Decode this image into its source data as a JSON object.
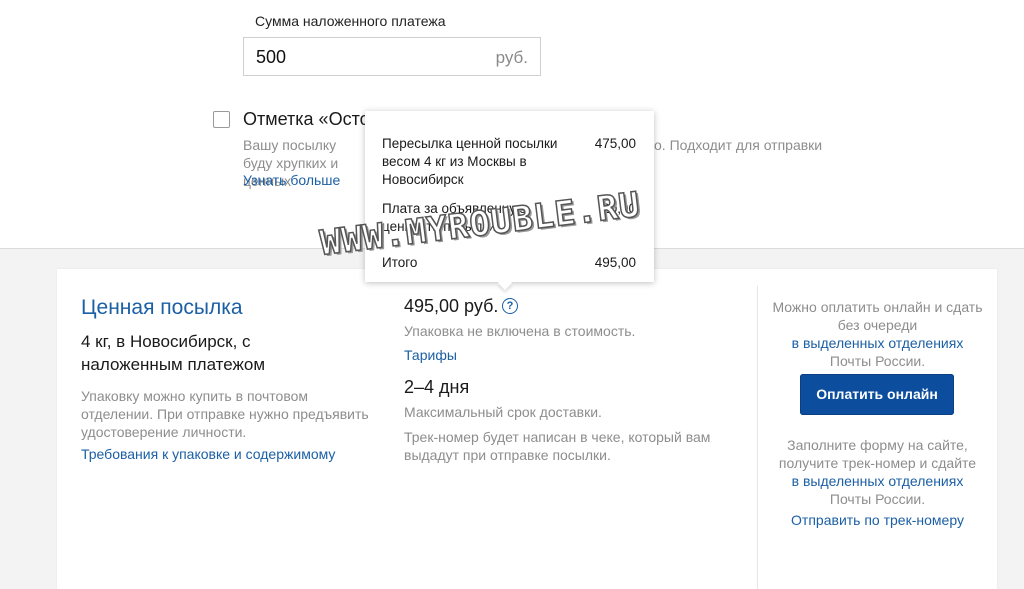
{
  "cod": {
    "label": "Сумма наложенного платежа",
    "value": "500",
    "unit": "руб."
  },
  "careful": {
    "label": "Отметка «Осто",
    "desc_left": "Вашу посылку буду хрупких и ценных",
    "desc_right": "о. Подходит для отправки",
    "learn_more": "Узнать больше"
  },
  "tooltip": {
    "rows": [
      {
        "label": "Пересылка ценной посылки весом 4 кг из Москвы в Новосибирск",
        "value": "475,00"
      },
      {
        "label": "Плата за объявленную ценность посылки",
        "value": "20,00"
      },
      {
        "label": "Итого",
        "value": "495,00"
      }
    ]
  },
  "watermark": "WWW.MYROUBLE.RU",
  "card": {
    "title": "Ценная посылка",
    "subtitle": "4 кг, в Новосибирск, с наложенным платежом",
    "note": "Упаковку можно купить в почтовом отделении. При отправке нужно предъявить удостоверение личности.",
    "requirements_link": "Требования к упаковке и содержимому",
    "price": "495,00 руб.",
    "help_icon": "?",
    "pack_note": "Упаковка не включена в стоимость.",
    "tariffs_link": "Тарифы",
    "days": "2–4 дня",
    "days_note": "Максимальный срок доставки.",
    "track_note": "Трек-номер будет написан в чеке, который вам выдадут при отправке посылки."
  },
  "right": {
    "block1_pre": "Можно оплатить онлайн и сдать без очереди",
    "block1_link": "в выделенных отделениях",
    "block1_post": "Почты России.",
    "pay_button": "Оплатить онлайн",
    "block2_pre": "Заполните форму на сайте, получите трек-номер и сдайте",
    "block2_link": "в выделенных отделениях",
    "block2_post": "Почты России.",
    "track_link": "Отправить по трек-номеру"
  },
  "colors": {
    "link": "#1b5fa5",
    "button": "#0d4d9e",
    "muted": "#8d8d8d",
    "background_bottom": "#f3f3f3"
  }
}
